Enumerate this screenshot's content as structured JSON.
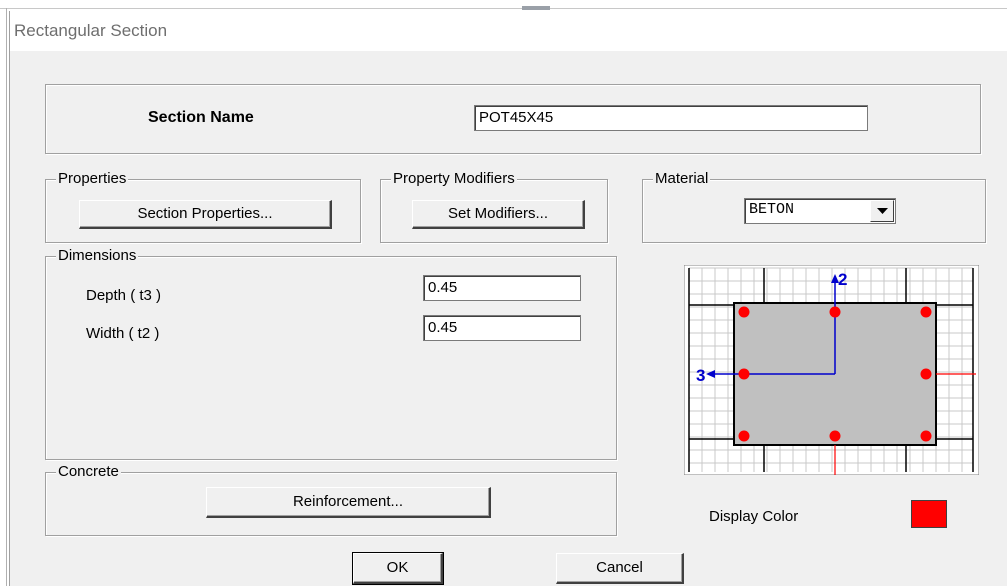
{
  "window": {
    "title": "Rectangular Section"
  },
  "section": {
    "label": "Section Name",
    "value": "POT45X45"
  },
  "properties": {
    "legend": "Properties",
    "button_label": "Section Properties..."
  },
  "modifiers": {
    "legend": "Property Modifiers",
    "button_label": "Set Modifiers..."
  },
  "material": {
    "legend": "Material",
    "selected": "BETON"
  },
  "dimensions": {
    "legend": "Dimensions",
    "depth_label": "Depth  ( t3 )",
    "depth_value": "0.45",
    "width_label": "Width  ( t2 )",
    "width_value": "0.45"
  },
  "concrete": {
    "legend": "Concrete",
    "button_label": "Reinforcement..."
  },
  "preview": {
    "axis2_label": "2",
    "axis3_label": "3",
    "rebar_color": "#ff0000",
    "axis_color": "#0000cc"
  },
  "display_color": {
    "label": "Display Color",
    "color": "#ff0000"
  },
  "buttons": {
    "ok": "OK",
    "cancel": "Cancel"
  }
}
